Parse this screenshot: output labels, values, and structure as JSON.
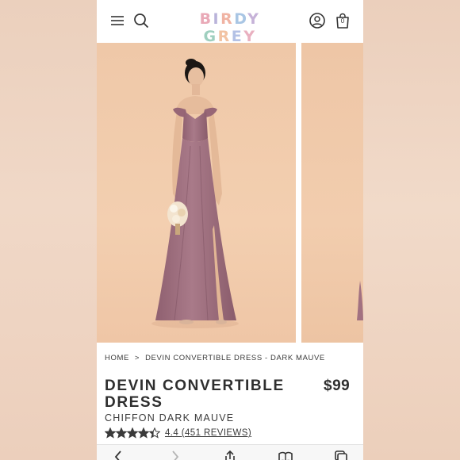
{
  "header": {
    "logo_letters": [
      "B",
      "I",
      "R",
      "D",
      "Y",
      " ",
      "G",
      "R",
      "E",
      "Y"
    ],
    "bag_count": "0",
    "icons": [
      "hamburger-menu-icon",
      "search-icon",
      "account-icon",
      "shopping-bag-icon"
    ]
  },
  "product": {
    "breadcrumb": {
      "home": "HOME",
      "separator": ">",
      "current": "DEVIN CONVERTIBLE DRESS - DARK MAUVE"
    },
    "title": "DEVIN CONVERTIBLE DRESS",
    "price": "$99",
    "subtitle": "CHIFFON DARK MAUVE",
    "rating_value": 4.4,
    "rating_text": "4.4 (451 REVIEWS)"
  },
  "toolbar": {
    "icons": [
      "back-icon",
      "forward-icon",
      "share-icon",
      "bookmarks-icon",
      "tabs-icon"
    ]
  },
  "colors": {
    "dress": "#a27181",
    "photo_background": "#f0caab",
    "text": "#2e2e2e",
    "star": "#3a3a3a"
  }
}
